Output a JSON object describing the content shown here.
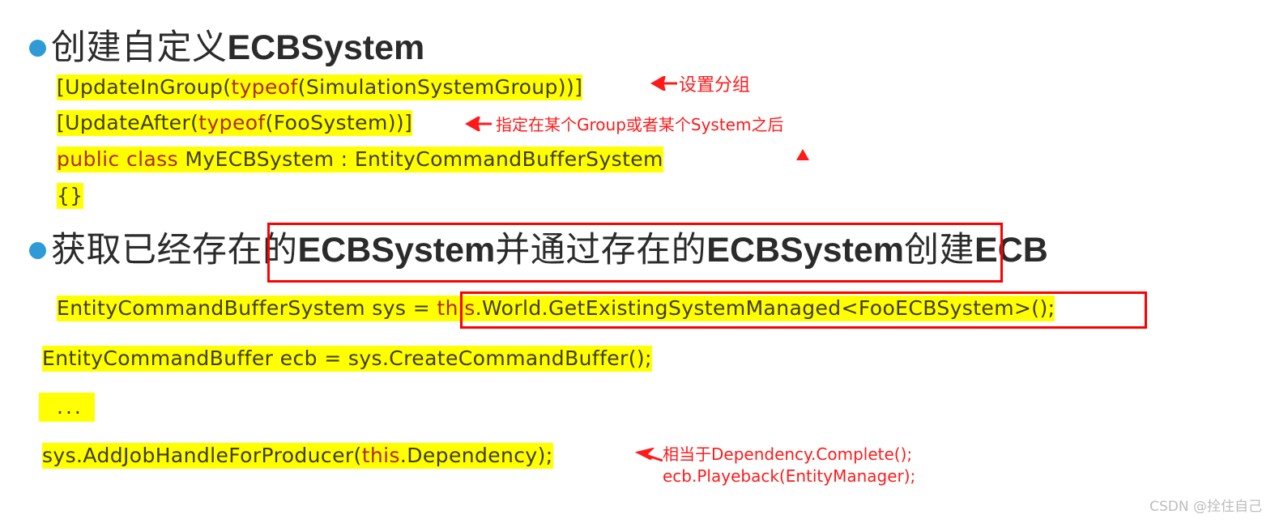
{
  "slide": {
    "background_color": "#ffffff",
    "bullet_color": "#2e9bd6",
    "highlight_color": "#ffff00",
    "annotation_color": "#ff1a1a",
    "box_color": "#ff0000",
    "keyword_color": "#b02a10",
    "code_color": "#403c10"
  },
  "headings": {
    "first": {
      "cn_prefix": "创建自定义",
      "latin": "ECBSystem",
      "full": "创建自定义ECBSystem"
    },
    "second": {
      "part1": "获取已经存在的",
      "latin1": "ECBSystem",
      "part2": "并通过存在的",
      "latin2": "ECBSystem",
      "part3": "创建",
      "latin3": "ECB",
      "full": "获取已经存在的ECBSystem并通过存在的ECBSystem创建ECB"
    }
  },
  "code_block_1": {
    "line1": {
      "pre": "[UpdateInGroup(",
      "keyword": "typeof",
      "post": "(SimulationSystemGroup))]",
      "full": "[UpdateInGroup(typeof(SimulationSystemGroup))]"
    },
    "line2": {
      "pre": "[UpdateAfter(",
      "keyword": "typeof",
      "post": "(FooSystem))]",
      "full": "[UpdateAfter(typeof(FooSystem))]"
    },
    "line3": {
      "keyword": "public class",
      "post": " MyECBSystem : EntityCommandBufferSystem",
      "full": "public class MyECBSystem : EntityCommandBufferSystem"
    },
    "line4": {
      "full": "{}"
    }
  },
  "code_block_2": {
    "line1": {
      "pre": "EntityCommandBufferSystem sys = ",
      "keyword": "this",
      "post": ".World.GetExistingSystemManaged<FooECBSystem>();",
      "full": "EntityCommandBufferSystem sys = this.World.GetExistingSystemManaged<FooECBSystem>();"
    },
    "line2": {
      "full": "EntityCommandBuffer ecb = sys.CreateCommandBuffer();"
    },
    "line3": {
      "full": "..."
    },
    "line4": {
      "pre": "sys.AddJobHandleForProducer(",
      "keyword": "this",
      "post": ".Dependency);",
      "full": "sys.AddJobHandleForProducer(this.Dependency);"
    }
  },
  "annotations": {
    "set_group": "设置分组",
    "specify_after": "指定在某个Group或者某个System之后",
    "equivalent_line1": "相当于Dependency.Complete();",
    "equivalent_line2": "ecb.Playeback(EntityManager);"
  },
  "watermark": {
    "text": "CSDN @拴住自己"
  }
}
